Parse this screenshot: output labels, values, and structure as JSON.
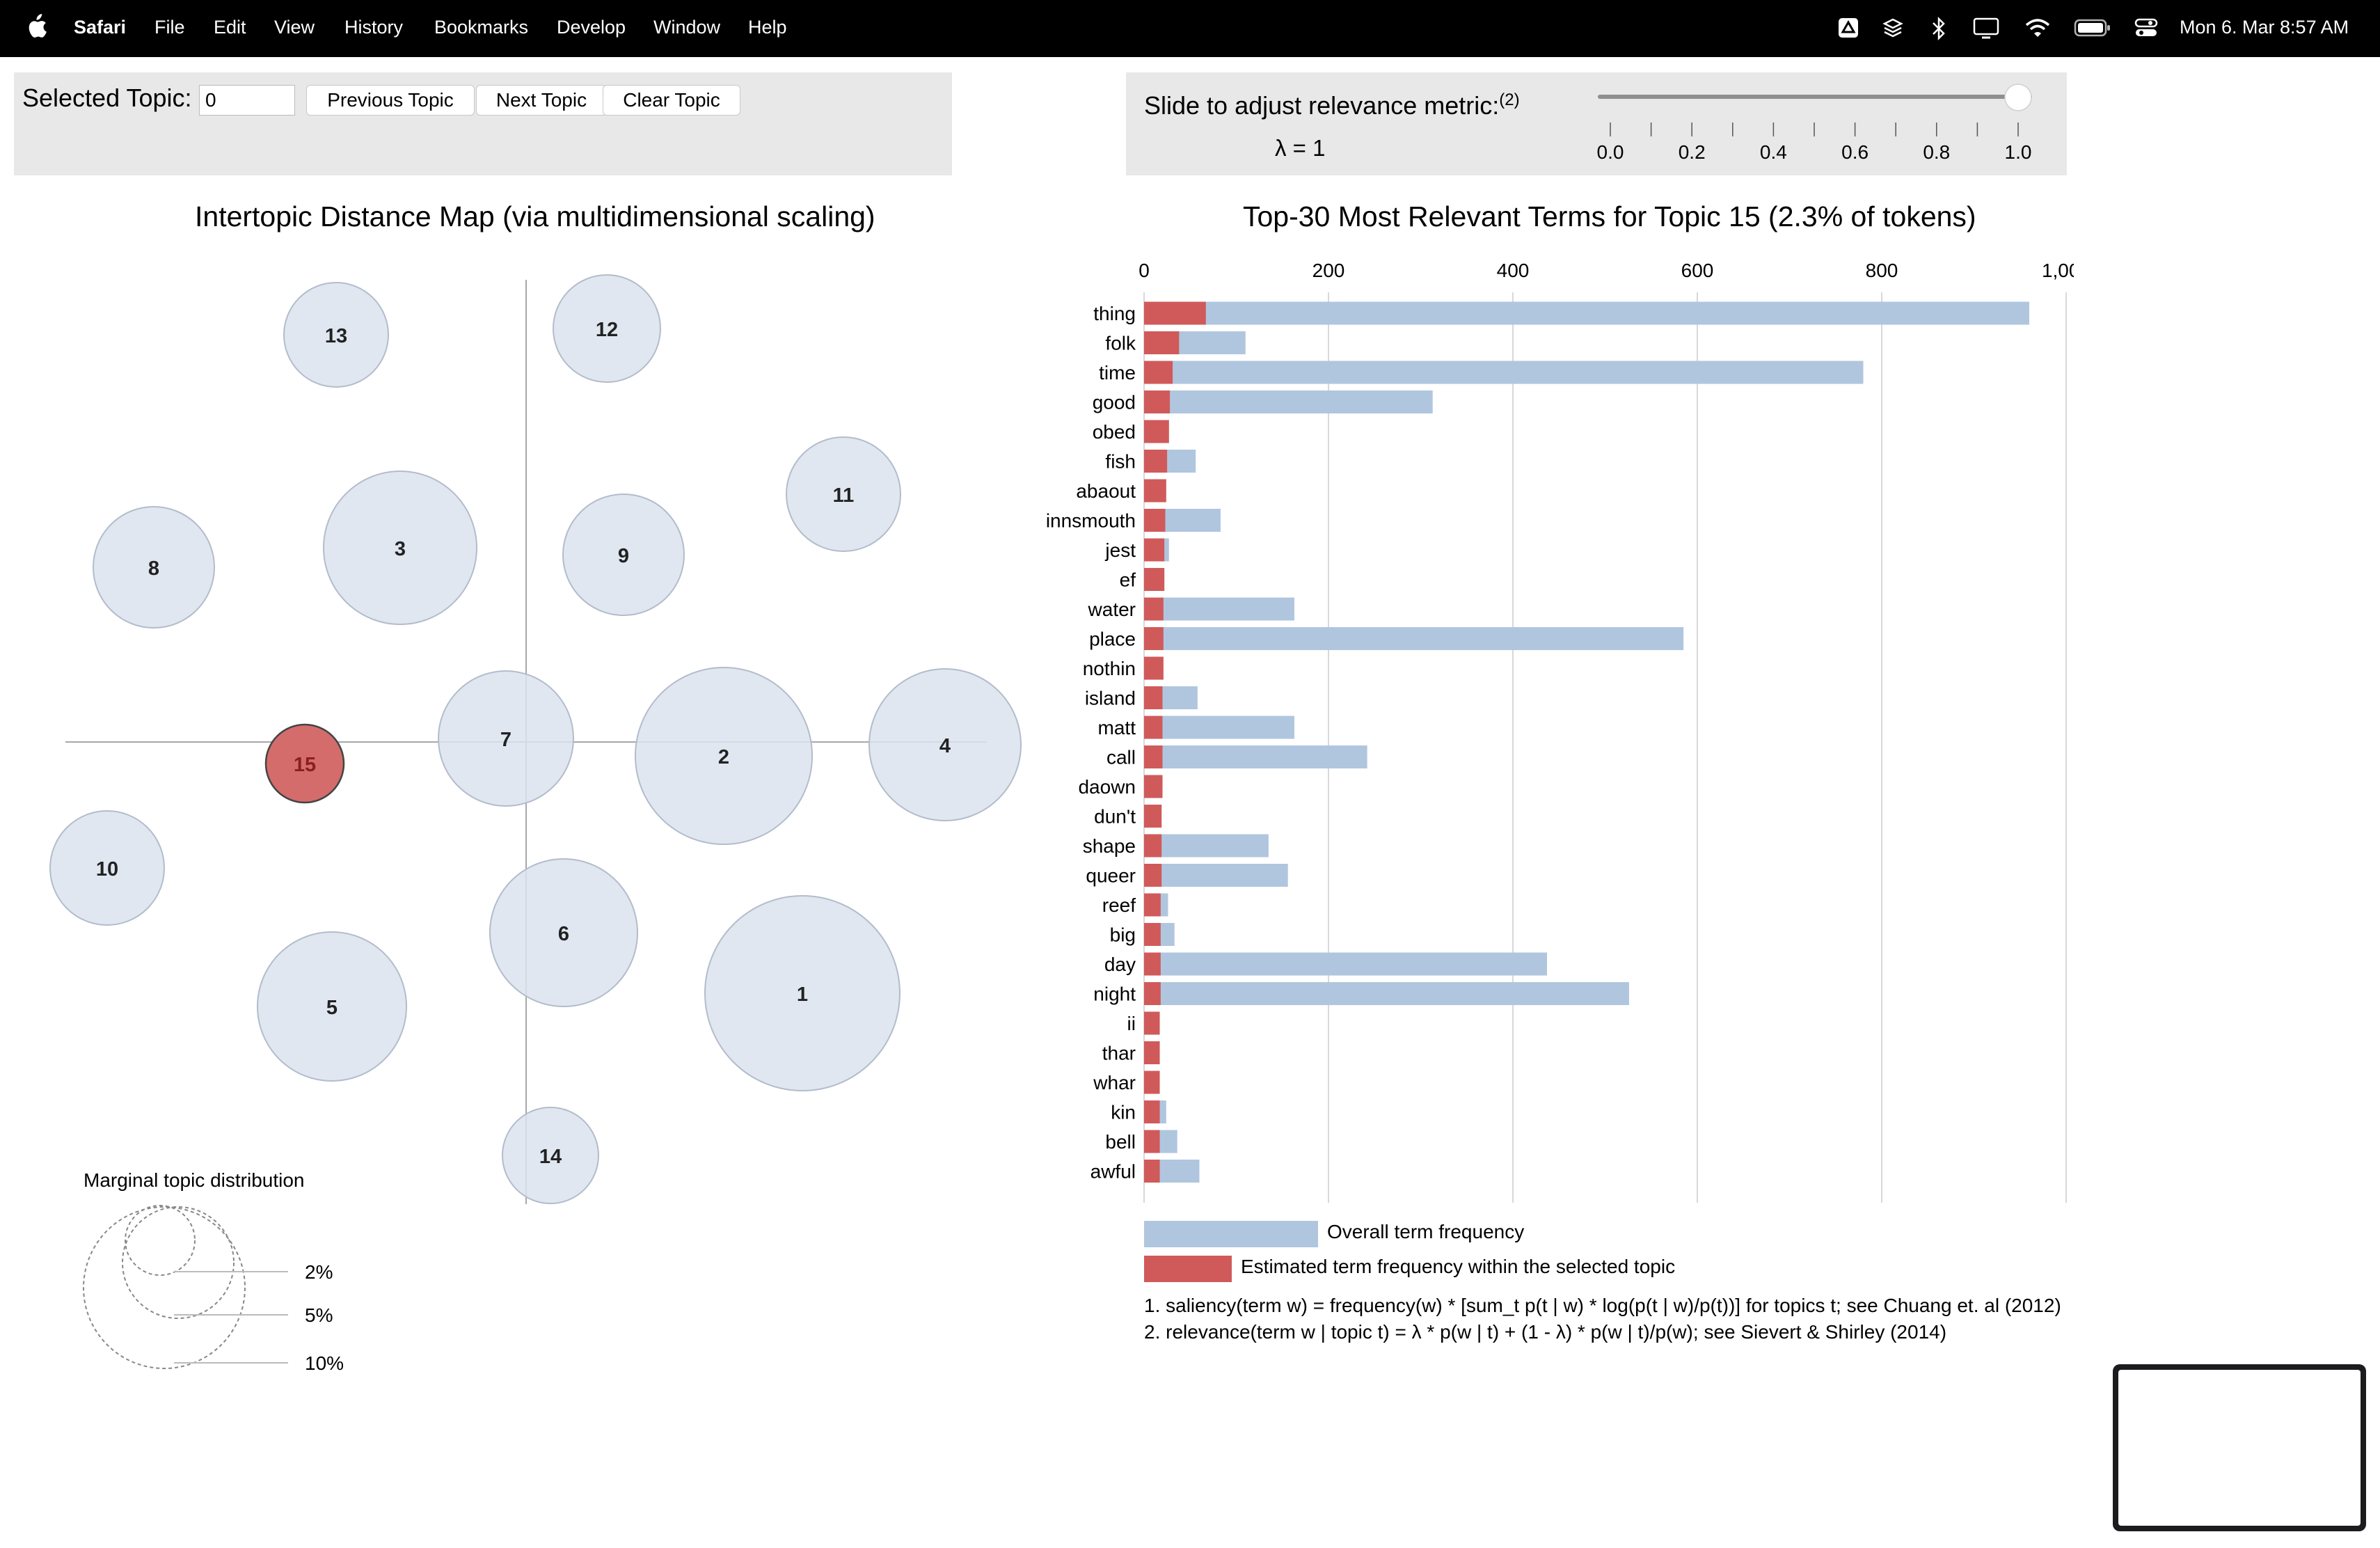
{
  "menubar": {
    "app": "Safari",
    "items": [
      "File",
      "Edit",
      "View",
      "History",
      "Bookmarks",
      "Develop",
      "Window",
      "Help"
    ],
    "clock": "Mon 6. Mar  8:57 AM",
    "status_icons": [
      "drive-icon",
      "layers-icon",
      "bluetooth-icon",
      "display-icon",
      "wifi-icon",
      "battery-icon",
      "control-center-icon"
    ]
  },
  "controls": {
    "selected_topic_label": "Selected Topic:",
    "selected_topic_value": "0",
    "prev_label": "Previous Topic",
    "next_label": "Next Topic",
    "clear_label": "Clear Topic",
    "slide_label": "Slide to adjust relevance metric:",
    "slide_sup": "(2)",
    "lambda_label": "λ = 1",
    "lambda_value": 1,
    "slider_ticks": [
      "0.0",
      "0.2",
      "0.4",
      "0.6",
      "0.8",
      "1.0"
    ]
  },
  "map": {
    "title": "Intertopic Distance Map (via multidimensional scaling)",
    "selected_topic": "15",
    "colors": {
      "topic_fill": "#dbe3ef",
      "topic_stroke": "#b3bccb",
      "selected_fill": "#d46c6c",
      "axis": "#a8a8a8"
    },
    "topics": [
      "13",
      "12",
      "11",
      "8",
      "3",
      "9",
      "7",
      "2",
      "4",
      "15",
      "10",
      "6",
      "5",
      "1",
      "14"
    ],
    "marginal_title": "Marginal topic distribution",
    "marginal_labels": [
      "2%",
      "5%",
      "10%"
    ]
  },
  "bars": {
    "title": "Top-30 Most Relevant Terms for Topic 15 (2.3% of tokens)",
    "colors": {
      "overall": "#b0c6df",
      "topic": "#d05a5a",
      "grid": "#d8d8d8"
    },
    "overall_legend": "Overall term frequency",
    "topic_legend": "Estimated term frequency within the selected topic",
    "footnote1": "1. saliency(term w) = frequency(w) * [sum_t p(t | w) * log(p(t | w)/p(t))] for topics t; see Chuang et. al (2012)",
    "footnote2": "2. relevance(term w | topic t) = λ * p(w | t) + (1 - λ) * p(w | t)/p(w); see Sievert & Shirley (2014)"
  },
  "chart_data": {
    "type": "bar",
    "orientation": "horizontal",
    "title": "Top-30 Most Relevant Terms for Topic 15 (2.3% of tokens)",
    "x_ticks": [
      "0",
      "200",
      "400",
      "600",
      "800",
      "1,000"
    ],
    "xlim": [
      0,
      1000
    ],
    "grid": true,
    "categories": [
      "thing",
      "folk",
      "time",
      "good",
      "obed",
      "fish",
      "abaout",
      "innsmouth",
      "jest",
      "ef",
      "water",
      "place",
      "nothin",
      "island",
      "matt",
      "call",
      "daown",
      "dun't",
      "shape",
      "queer",
      "reef",
      "big",
      "day",
      "night",
      "ii",
      "thar",
      "whar",
      "kin",
      "bell",
      "awful"
    ],
    "series": [
      {
        "name": "Overall term frequency",
        "values": [
          960,
          110,
          780,
          313,
          27,
          56,
          24,
          83,
          27,
          22,
          163,
          585,
          21,
          58,
          163,
          242,
          20,
          19,
          135,
          156,
          26,
          33,
          437,
          526,
          17,
          17,
          17,
          24,
          36,
          60
        ]
      },
      {
        "name": "Estimated term frequency within the selected topic",
        "values": [
          67,
          38,
          31,
          28,
          27,
          25,
          24,
          23,
          22,
          22,
          21,
          21,
          21,
          20,
          20,
          20,
          20,
          19,
          19,
          19,
          18,
          18,
          18,
          18,
          17,
          17,
          17,
          17,
          17,
          17
        ]
      }
    ]
  }
}
